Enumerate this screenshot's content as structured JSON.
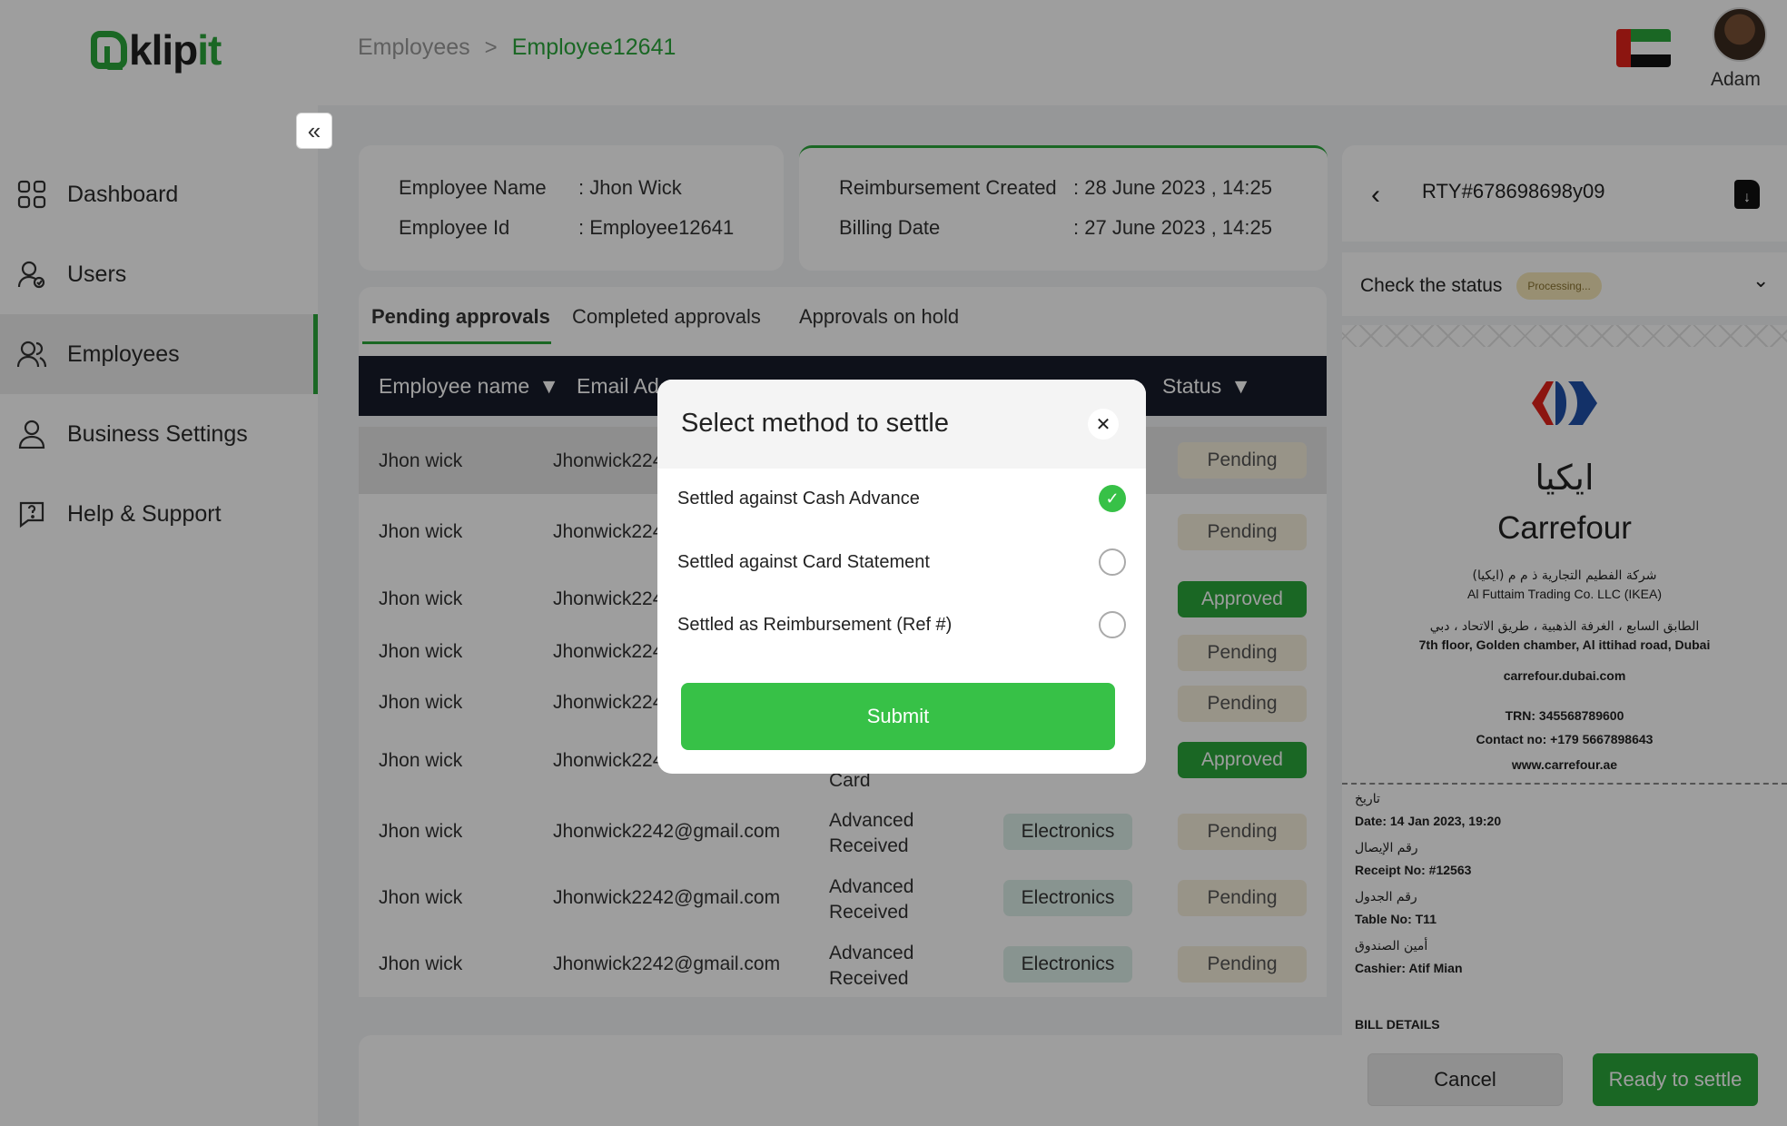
{
  "app": {
    "logo_text_main": "klip",
    "logo_text_accent": "it"
  },
  "sidebar": {
    "items": [
      {
        "label": "Dashboard",
        "icon": "dashboard-icon"
      },
      {
        "label": "Users",
        "icon": "users-icon"
      },
      {
        "label": "Employees",
        "icon": "employees-icon",
        "active": true
      },
      {
        "label": "Business Settings",
        "icon": "business-settings-icon"
      },
      {
        "label": "Help & Support",
        "icon": "help-support-icon"
      }
    ]
  },
  "breadcrumb": {
    "parent": "Employees",
    "current": "Employee12641"
  },
  "user": {
    "name": "Adam"
  },
  "employee_card": {
    "name_label": "Employee Name",
    "name_value": "Jhon Wick",
    "id_label": "Employee Id",
    "id_value": "Employee12641"
  },
  "reimbursement_card": {
    "created_label": "Reimbursement Created",
    "created_value": "28 June 2023 , 14:25",
    "billing_label": "Billing Date",
    "billing_value": "27 June 2023 , 14:25"
  },
  "tabs": [
    "Pending approvals",
    "Completed approvals",
    "Approvals on hold"
  ],
  "table": {
    "headers": [
      "Employee name",
      "Email Ad",
      "Status"
    ],
    "rows": [
      {
        "name": "Jhon wick",
        "email": "Jhonwick224",
        "type": "",
        "category": "",
        "status": "Pending"
      },
      {
        "name": "Jhon wick",
        "email": "Jhonwick224",
        "type": "",
        "category": "",
        "status": "Pending"
      },
      {
        "name": "Jhon wick",
        "email": "Jhonwick224",
        "type": "",
        "category": "",
        "status": "Approved"
      },
      {
        "name": "Jhon wick",
        "email": "Jhonwick224",
        "type": "",
        "category": "",
        "status": "Pending"
      },
      {
        "name": "Jhon wick",
        "email": "Jhonwick224",
        "type": "",
        "category": "",
        "status": "Pending"
      },
      {
        "name": "Jhon wick",
        "email": "Jhonwick224",
        "type": "Card",
        "category": "",
        "status": "Approved"
      },
      {
        "name": "Jhon wick",
        "email": "Jhonwick2242@gmail.com",
        "type": "Advanced Received",
        "category": "Electronics",
        "status": "Pending"
      },
      {
        "name": "Jhon wick",
        "email": "Jhonwick2242@gmail.com",
        "type": "Advanced Received",
        "category": "Electronics",
        "status": "Pending"
      },
      {
        "name": "Jhon wick",
        "email": "Jhonwick2242@gmail.com",
        "type": "Advanced Received",
        "category": "Electronics",
        "status": "Pending"
      }
    ]
  },
  "footer": {
    "cancel_label": "Cancel",
    "ready_label": "Ready to settle"
  },
  "receipt_panel": {
    "ref": "RTY#678698698y09",
    "status_label": "Check the status",
    "status_badge": "Processing...",
    "store_ar": "ايكيا",
    "store_en": "Carrefour",
    "company_ar": "شركة الفطيم التجارية ذ م م (ايكيا)",
    "company_en": "Al Futtaim Trading Co. LLC (IKEA)",
    "address_ar": "الطابق السابع ، الغرفة الذهبية ، طريق الاتحاد ، دبي",
    "address_en": "7th floor, Golden chamber, Al ittihad road, Dubai",
    "site": "carrefour.dubai.com",
    "trn": "TRN: 345568789600",
    "contact": "Contact no:  +179 5667898643",
    "web": "www.carrefour.ae",
    "date_ar": "تاريخ",
    "date_en": "Date: 14 Jan 2023, 19:20",
    "receipt_ar": "رقم الإيصال",
    "receipt_en": "Receipt No: #12563",
    "table_ar": "رقم الجدول",
    "table_en": "Table No: T11",
    "cashier_ar": "أمين الصندوق",
    "cashier_en": "Cashier: Atif Mian",
    "bill_details": "BILL DETAILS"
  },
  "modal": {
    "title": "Select method to settle",
    "options": [
      {
        "label": "Settled against Cash Advance",
        "selected": true
      },
      {
        "label": "Settled against Card Statement",
        "selected": false
      },
      {
        "label": "Settled as Reimbursement (Ref #)",
        "selected": false
      }
    ],
    "submit_label": "Submit"
  },
  "colors": {
    "brand_green": "#2aa63b",
    "submit_green": "#37c147",
    "header_dark": "#171c2b"
  }
}
